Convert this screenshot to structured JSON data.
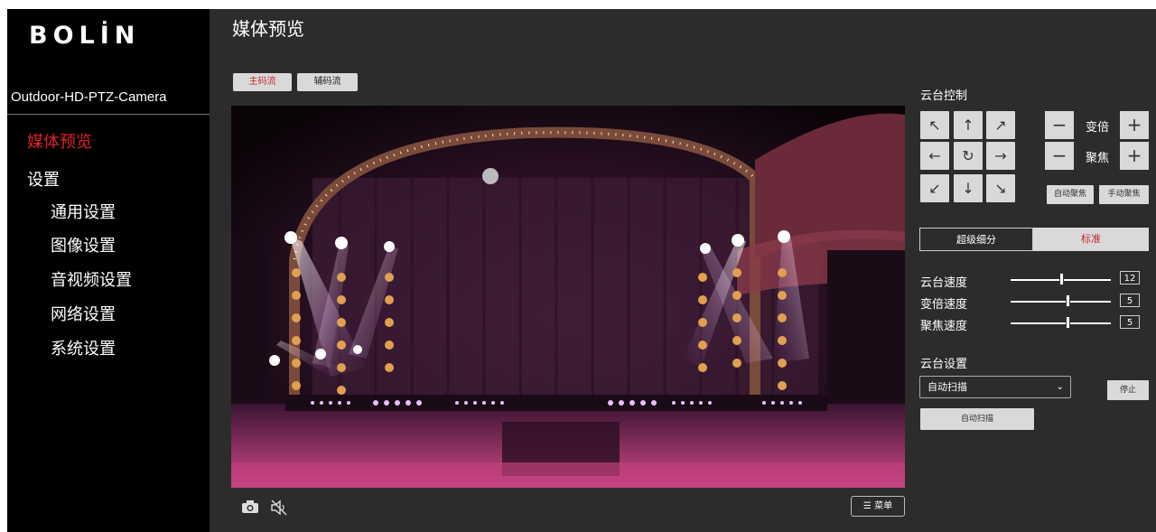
{
  "brand": {
    "logo": "BOLİN",
    "model": "Outdoor-HD-PTZ-Camera"
  },
  "nav": {
    "media_preview": "媒体预览",
    "settings": "设置",
    "general": "通用设置",
    "image": "图像设置",
    "av": "音视频设置",
    "network": "网络设置",
    "system": "系统设置"
  },
  "page": {
    "title": "媒体预览"
  },
  "stream": {
    "main": "主码流",
    "sub": "辅码流"
  },
  "player": {
    "camera_icon": "camera-icon",
    "mute_icon": "mute-icon",
    "menu_label": "菜单"
  },
  "ptz": {
    "title": "云台控制",
    "arrows": {
      "up_left": "↖",
      "up": "↑",
      "up_right": "↗",
      "left": "←",
      "home": "↻",
      "right": "→",
      "down_left": "↙",
      "down": "↓",
      "down_right": "↘"
    },
    "zoom_label": "变倍",
    "focus_label": "聚焦",
    "minus": "−",
    "plus": "+",
    "auto_focus": "自动聚焦",
    "manual_focus": "手动聚焦",
    "mode_fine": "超级细分",
    "mode_standard": "标准"
  },
  "speeds": {
    "pan_label": "云台速度",
    "pan_value": "12",
    "pan_level": 0.5,
    "zoom_label": "变倍速度",
    "zoom_value": "5",
    "zoom_level": 0.57,
    "focus_label": "聚焦速度",
    "focus_value": "5",
    "focus_level": 0.57
  },
  "ptz_settings": {
    "title": "云台设置",
    "selected": "自动扫描",
    "stop": "停止",
    "action": "自动扫描"
  },
  "colors": {
    "accent": "#e0202a",
    "button_bg": "#d9d9d9",
    "panel_bg": "#2c2c2c"
  }
}
